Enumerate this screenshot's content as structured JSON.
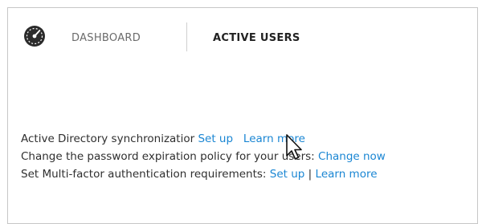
{
  "header": {
    "tabs": [
      {
        "label": "DASHBOARD"
      },
      {
        "label": "ACTIVE USERS"
      }
    ]
  },
  "settings": {
    "ad_sync": {
      "text": "Active Directory synchronizatior ",
      "setup_link": "Set up",
      "learn_link": "Learn more"
    },
    "password_policy": {
      "text": "Change the password expiration policy for your users: ",
      "change_link": "Change now"
    },
    "mfa": {
      "text": "Set Multi-factor authentication requirements: ",
      "setup_link": "Set up",
      "separator": "|",
      "learn_link": "Learn more"
    }
  },
  "icons": {
    "dashboard": "speedometer-icon",
    "cursor": "mouse-pointer-icon"
  },
  "colors": {
    "link": "#1a86d3",
    "text": "#2f2f2f",
    "tab_inactive": "#6b6b6b",
    "tab_active": "#222222"
  }
}
